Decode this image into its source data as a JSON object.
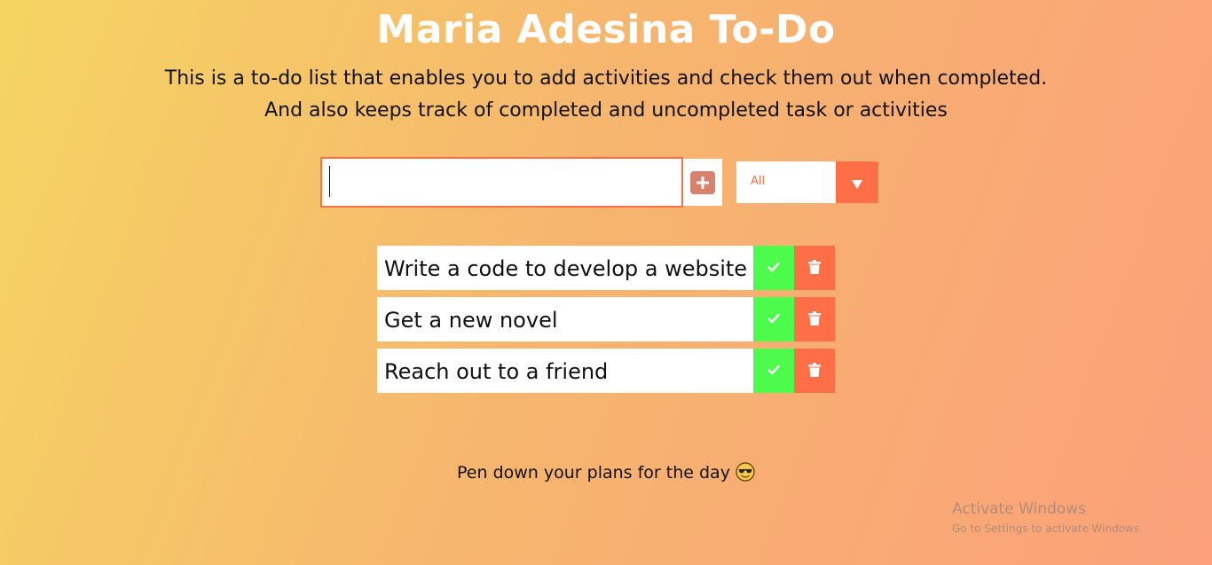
{
  "header": {
    "title": "Maria Adesina To-Do",
    "description_line1": "This is a to-do list that enables you to add activities and check them out when completed.",
    "description_line2": "And also keeps track of completed and uncompleted task or activities"
  },
  "form": {
    "input_value": "",
    "add_icon": "plus-square-icon",
    "filter": {
      "selected": "All",
      "arrow_icon": "caret-down-icon"
    }
  },
  "todos": [
    {
      "text": "Write a code to develop a website"
    },
    {
      "text": "Get a new novel"
    },
    {
      "text": "Reach out to a friend"
    }
  ],
  "todo_actions": {
    "complete_icon": "check-icon",
    "delete_icon": "trash-icon"
  },
  "footer": {
    "note": "Pen down your plans for the day",
    "emoji_icon": "sunglasses-emoji-icon"
  },
  "system_watermark": {
    "title": "Activate Windows",
    "subtitle": "Go to Settings to activate Windows."
  },
  "colors": {
    "accent": "#ff6f47",
    "complete": "#4cfb4c",
    "add_button": "#d9826b",
    "title": "#ffffff",
    "gradient_start": "#f5d562",
    "gradient_end": "#fba07a"
  }
}
